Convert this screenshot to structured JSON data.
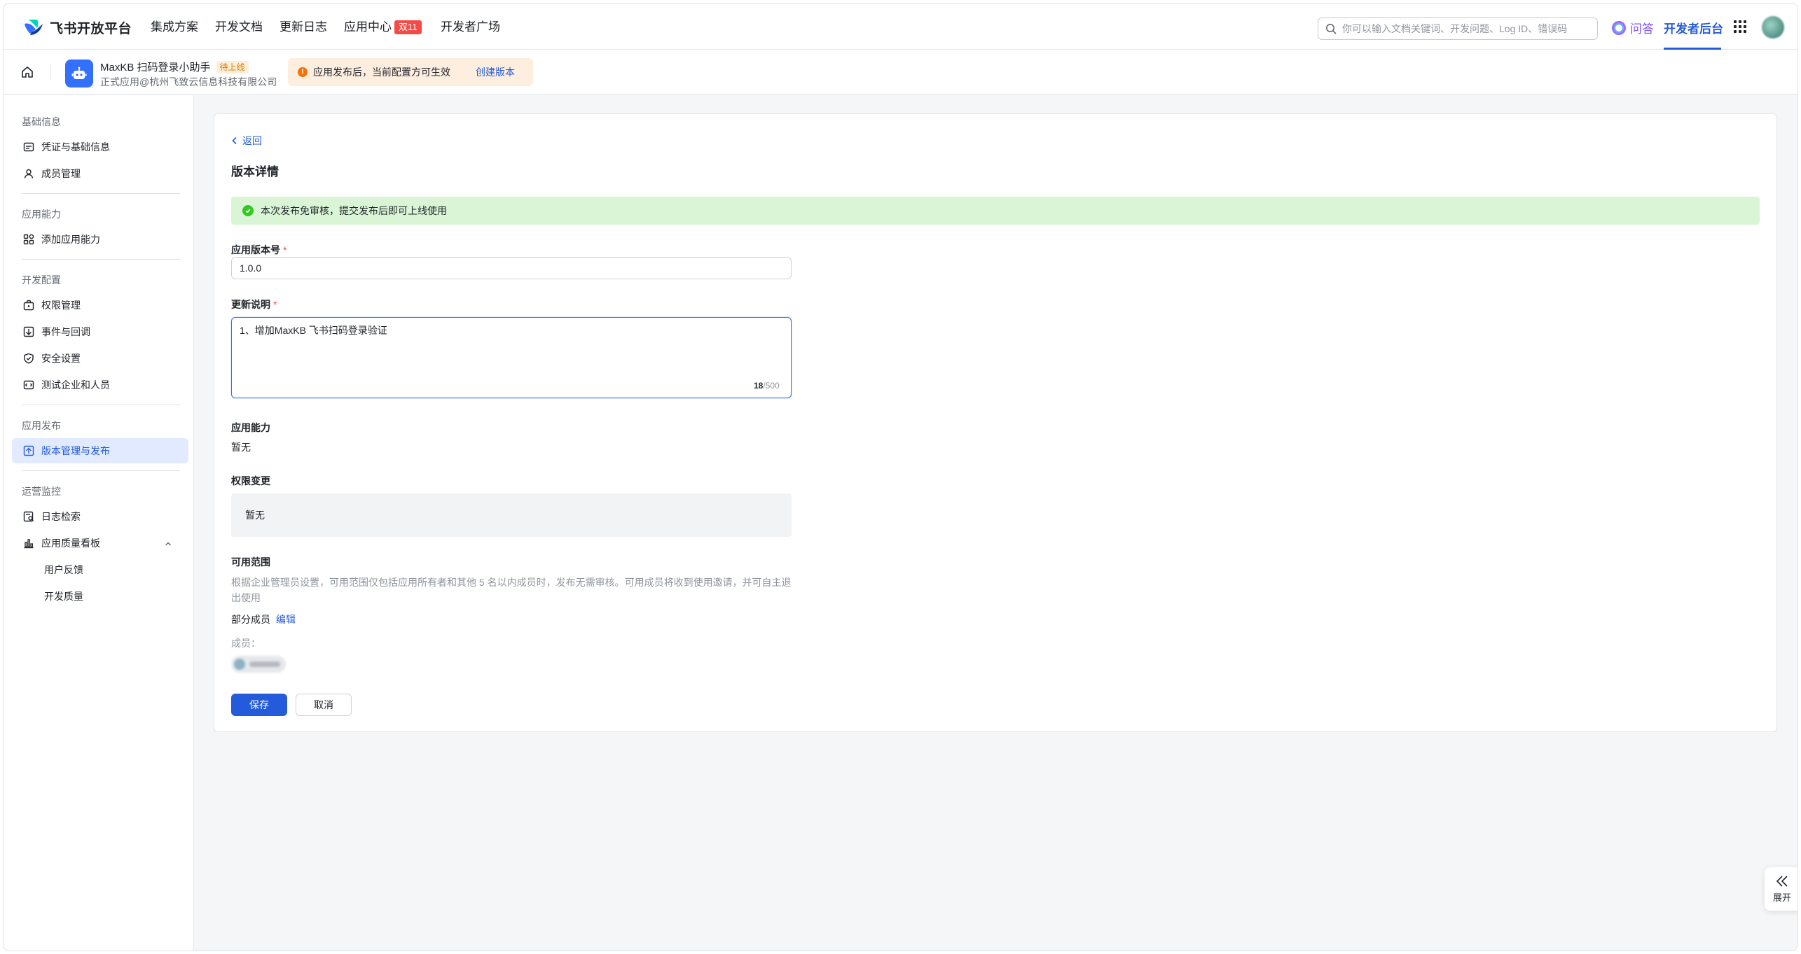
{
  "topnav": {
    "brand": "飞书开放平台",
    "items": [
      {
        "label": "集成方案"
      },
      {
        "label": "开发文档"
      },
      {
        "label": "更新日志"
      },
      {
        "label": "应用中心",
        "badge": "双11"
      },
      {
        "label": "开发者广场"
      }
    ],
    "search_placeholder": "你可以输入文档关键词、开发问题、Log ID、错误码",
    "qa_label": "问答",
    "dev_console": "开发者后台"
  },
  "app": {
    "name": "MaxKB 扫码登录小助手",
    "status": "待上线",
    "subtitle": "正式应用@杭州飞致云信息科技有限公司",
    "notice": "应用发布后，当前配置方可生效",
    "notice_link": "创建版本"
  },
  "sidebar": {
    "groups": [
      {
        "title": "基础信息",
        "items": [
          {
            "label": "凭证与基础信息",
            "icon": "credential-icon"
          },
          {
            "label": "成员管理",
            "icon": "user-icon"
          }
        ]
      },
      {
        "title": "应用能力",
        "items": [
          {
            "label": "添加应用能力",
            "icon": "add-capability-icon"
          }
        ]
      },
      {
        "title": "开发配置",
        "items": [
          {
            "label": "权限管理",
            "icon": "permission-icon"
          },
          {
            "label": "事件与回调",
            "icon": "event-icon"
          },
          {
            "label": "安全设置",
            "icon": "shield-icon"
          },
          {
            "label": "测试企业和人员",
            "icon": "test-icon"
          }
        ]
      },
      {
        "title": "应用发布",
        "items": [
          {
            "label": "版本管理与发布",
            "icon": "publish-icon",
            "active": true
          }
        ]
      },
      {
        "title": "运营监控",
        "items": [
          {
            "label": "日志检索",
            "icon": "log-icon"
          },
          {
            "label": "应用质量看板",
            "icon": "chart-icon",
            "expanded": true,
            "children": [
              "用户反馈",
              "开发质量"
            ]
          }
        ]
      }
    ]
  },
  "main": {
    "back": "返回",
    "title": "版本详情",
    "success_notice": "本次发布免审核，提交发布后即可上线使用",
    "version_label": "应用版本号",
    "version_value": "1.0.0",
    "notes_label": "更新说明",
    "notes_value": "1、增加MaxKB 飞书扫码登录验证",
    "notes_count": "18",
    "notes_max": "/500",
    "capability_label": "应用能力",
    "capability_value": "暂无",
    "permission_label": "权限变更",
    "permission_value": "暂无",
    "scope_label": "可用范围",
    "scope_desc": "根据企业管理员设置，可用范围仅包括应用所有者和其他 5 名以内成员时，发布无需审核。可用成员将收到使用邀请，并可自主退出使用",
    "scope_mode": "部分成员",
    "scope_edit": "编辑",
    "members_label": "成员：",
    "save": "保存",
    "cancel": "取消"
  },
  "expand_label": "展开",
  "colors": {
    "primary": "#245bdb",
    "success": "#34c724",
    "warning": "#f2720c",
    "danger": "#f54a45"
  }
}
